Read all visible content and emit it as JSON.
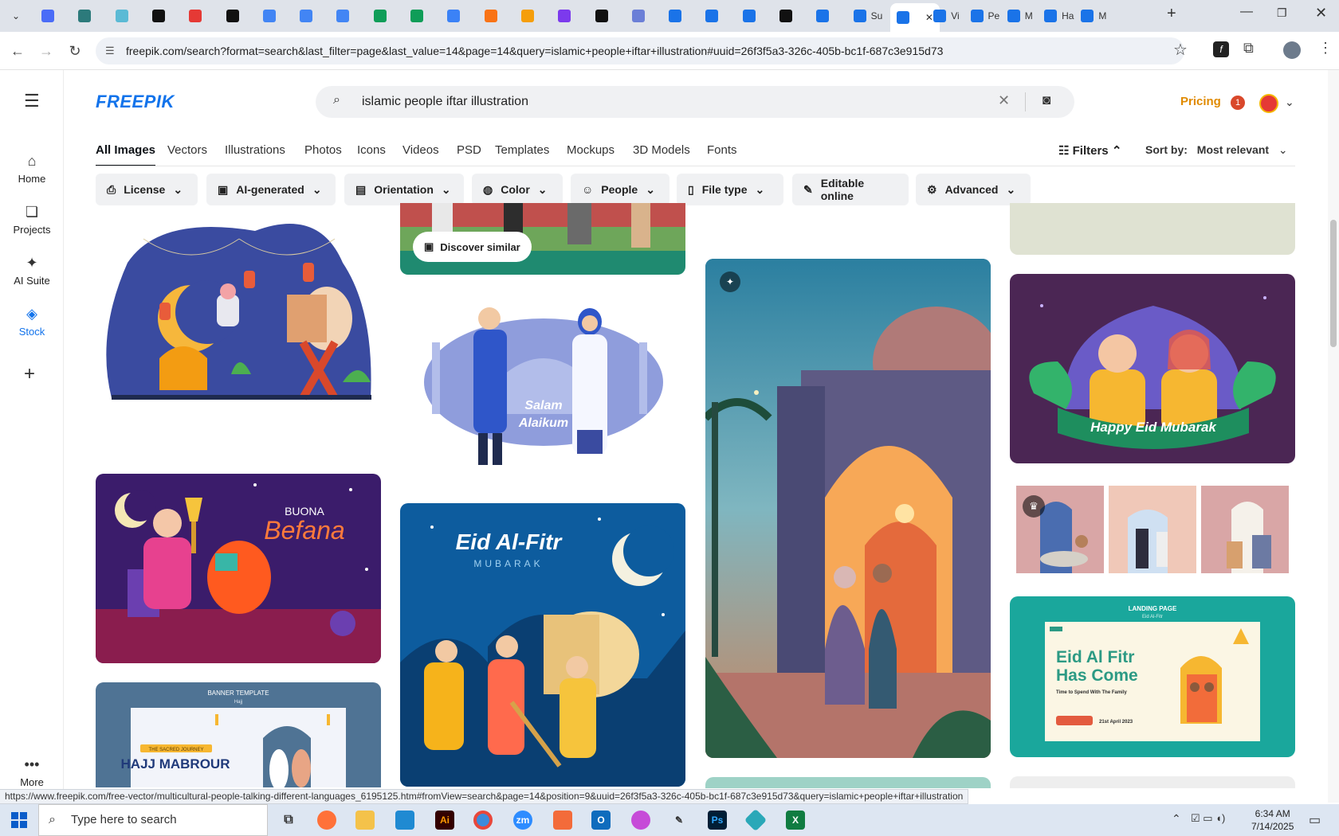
{
  "browser": {
    "tabs": [
      {
        "label": "",
        "color": "#4a6cf7"
      },
      {
        "label": "",
        "color": "#2c7a7b"
      },
      {
        "label": "",
        "color": "#5bbad5"
      },
      {
        "label": "",
        "color": "#111111"
      },
      {
        "label": "",
        "color": "#e53935"
      },
      {
        "label": "",
        "color": "#111111"
      },
      {
        "label": "",
        "color": "#4285f4"
      },
      {
        "label": "",
        "color": "#4285f4"
      },
      {
        "label": "",
        "color": "#4285f4"
      },
      {
        "label": "",
        "color": "#0f9d58"
      },
      {
        "label": "",
        "color": "#0f9d58"
      },
      {
        "label": "",
        "color": "#3b82f6"
      },
      {
        "label": "",
        "color": "#f97316"
      },
      {
        "label": "",
        "color": "#f59e0b"
      },
      {
        "label": "",
        "color": "#7c3aed"
      },
      {
        "label": "",
        "color": "#111111"
      },
      {
        "label": "",
        "color": "#6b7fd7"
      },
      {
        "label": "",
        "color": "#1a73e8"
      },
      {
        "label": "",
        "color": "#1a73e8"
      },
      {
        "label": "",
        "color": "#1a73e8"
      },
      {
        "label": "",
        "color": "#111111"
      },
      {
        "label": "",
        "color": "#1a73e8"
      },
      {
        "label": "Su",
        "color": "#1a73e8"
      },
      {
        "label": "",
        "color": "#1a73e8"
      },
      {
        "label": "Vi",
        "color": "#1a73e8"
      },
      {
        "label": "Pe",
        "color": "#1a73e8"
      },
      {
        "label": "M",
        "color": "#1a73e8"
      },
      {
        "label": "Ha",
        "color": "#1a73e8"
      },
      {
        "label": "M",
        "color": "#1a73e8"
      }
    ],
    "url": "freepik.com/search?format=search&last_filter=page&last_value=14&page=14&query=islamic+people+iftar+illustration#uuid=26f3f5a3-326c-405b-bc1f-687c3e915d73",
    "status_url": "https://www.freepik.com/free-vector/multicultural-people-talking-different-languages_6195125.htm#fromView=search&page=14&position=9&uuid=26f3f5a3-326c-405b-bc1f-687c3e915d73&query=islamic+people+iftar+illustration"
  },
  "sidebar": {
    "items": [
      {
        "label": "Home",
        "icon": "home-icon"
      },
      {
        "label": "Projects",
        "icon": "projects-icon"
      },
      {
        "label": "AI Suite",
        "icon": "sparkle-icon"
      },
      {
        "label": "Stock",
        "icon": "stock-icon"
      }
    ],
    "more_label": "More"
  },
  "header": {
    "logo": "FREEPIK",
    "search_query": "islamic people iftar illustration",
    "pricing_label": "Pricing",
    "notification_count": "1"
  },
  "tabs": [
    "All Images",
    "Vectors",
    "Illustrations",
    "Photos",
    "Icons",
    "Videos",
    "PSD",
    "Templates",
    "Mockups",
    "3D Models",
    "Fonts"
  ],
  "filters_label": "Filters",
  "sort": {
    "label": "Sort by:",
    "value": "Most relevant"
  },
  "chips": [
    "License",
    "AI-generated",
    "Orientation",
    "Color",
    "People",
    "File type",
    "Editable online",
    "Advanced"
  ],
  "cards": {
    "discover_similar": "Discover similar",
    "salam_line1": "Salam",
    "salam_line2": "Alaikum",
    "eid_mubarak": "Happy Eid Mubarak",
    "befana_line1": "BUONA",
    "befana_line2": "Befana",
    "eid_fitr_title": "Eid Al-Fitr",
    "eid_fitr_sub": "MUBARAK",
    "landing_small": "LANDING PAGE",
    "landing_small2": "Eid Al-Fitr",
    "landing_title1": "Eid Al Fitr",
    "landing_title2": "Has Come",
    "landing_sub": "Time to Spend With The Family",
    "landing_date": "21st April 2023",
    "banner_small": "BANNER TEMPLATE",
    "banner_small2": "Hajj",
    "banner_tag": "THE SACRED JOURNEY",
    "banner_title": "HAJJ MABROUR"
  },
  "taskbar": {
    "search_placeholder": "Type here to search",
    "time": "6:34 AM",
    "date": "7/14/2025"
  }
}
